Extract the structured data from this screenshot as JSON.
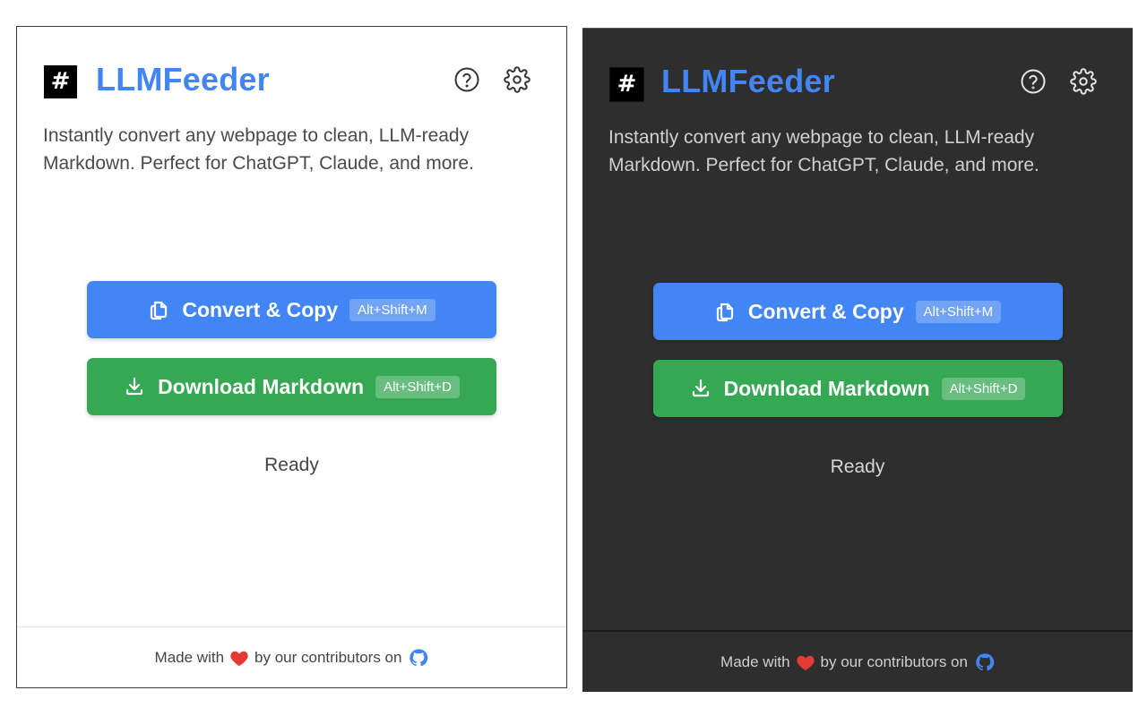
{
  "colors": {
    "accent_blue": "#4285f4",
    "accent_green": "#34a853",
    "dark_background": "#2e2e2e",
    "heart_red": "#e53935"
  },
  "light": {
    "app": {
      "logo_glyph": "#",
      "title": "LLMFeeder",
      "description": "Instantly convert any webpage to clean, LLM-ready Markdown. Perfect for ChatGPT, Claude, and more."
    },
    "header_icons": [
      "help-icon",
      "gear-icon"
    ],
    "actions": {
      "convert_label": "Convert & Copy",
      "convert_shortcut": "Alt+Shift+M",
      "download_label": "Download Markdown",
      "download_shortcut": "Alt+Shift+D"
    },
    "status": "Ready",
    "footer": {
      "made_with": "Made with",
      "by_text": "by our contributors on"
    }
  },
  "dark": {
    "app": {
      "logo_glyph": "#",
      "title": "LLMFeeder",
      "description": "Instantly convert any webpage to clean, LLM-ready Markdown. Perfect for ChatGPT, Claude, and more."
    },
    "header_icons": [
      "help-icon",
      "gear-icon"
    ],
    "actions": {
      "convert_label": "Convert & Copy",
      "convert_shortcut": "Alt+Shift+M",
      "download_label": "Download Markdown",
      "download_shortcut": "Alt+Shift+D"
    },
    "status": "Ready",
    "footer": {
      "made_with": "Made with",
      "by_text": "by our contributors on"
    }
  }
}
